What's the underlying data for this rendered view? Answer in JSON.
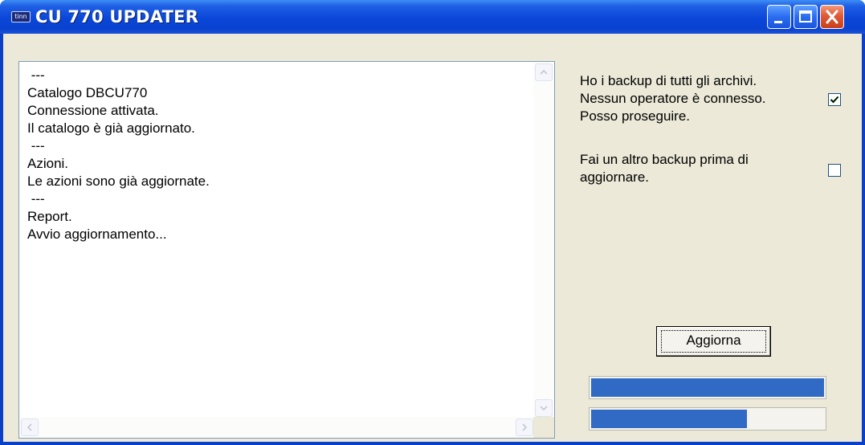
{
  "window": {
    "icon_text": "tinn",
    "title": "CU 770 UPDATER"
  },
  "log": {
    "lines": [
      " ---",
      "Catalogo DBCU770",
      "Connessione attivata.",
      "Il catalogo è già aggiornato.",
      " ---",
      "Azioni.",
      "Le azioni sono già aggiornate.",
      " ---",
      "Report.",
      "Avvio aggiornamento..."
    ]
  },
  "options": {
    "backup_confirm": {
      "line1": "Ho i backup di tutti gli archivi.",
      "line2": "Nessun operatore è connesso.",
      "line3": "Posso proseguire.",
      "checked": true
    },
    "extra_backup": {
      "line1": "Fai un altro backup prima di",
      "line2": "aggiornare.",
      "checked": false
    }
  },
  "actions": {
    "update_label": "Aggiorna"
  },
  "progress": {
    "overall": 1.0,
    "current": 0.67
  },
  "colors": {
    "titlebar": "#0a46d8",
    "progress_fill": "#316ac5",
    "client_bg": "#ece9d8"
  }
}
